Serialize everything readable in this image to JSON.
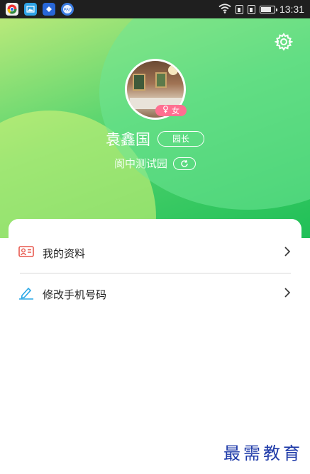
{
  "status_bar": {
    "apps": [
      "chrome-icon",
      "gallery-icon",
      "vpn-icon",
      "pay-icon"
    ],
    "time": "13:31"
  },
  "profile": {
    "name": "袁鑫国",
    "role": "园长",
    "gender": "女",
    "school": "阆中测试园"
  },
  "menu": [
    {
      "label": "我的资料",
      "icon": "profile-card-icon"
    },
    {
      "label": "修改手机号码",
      "icon": "edit-pencil-icon"
    }
  ],
  "watermark": "最需教育",
  "colors": {
    "header_green": "#1fbf57",
    "header_light": "#b9e97a",
    "badge_pink": "#ff6f91",
    "profile_icon": "#e8594f",
    "edit_icon": "#28a7e6",
    "watermark": "#1e3aa8"
  }
}
